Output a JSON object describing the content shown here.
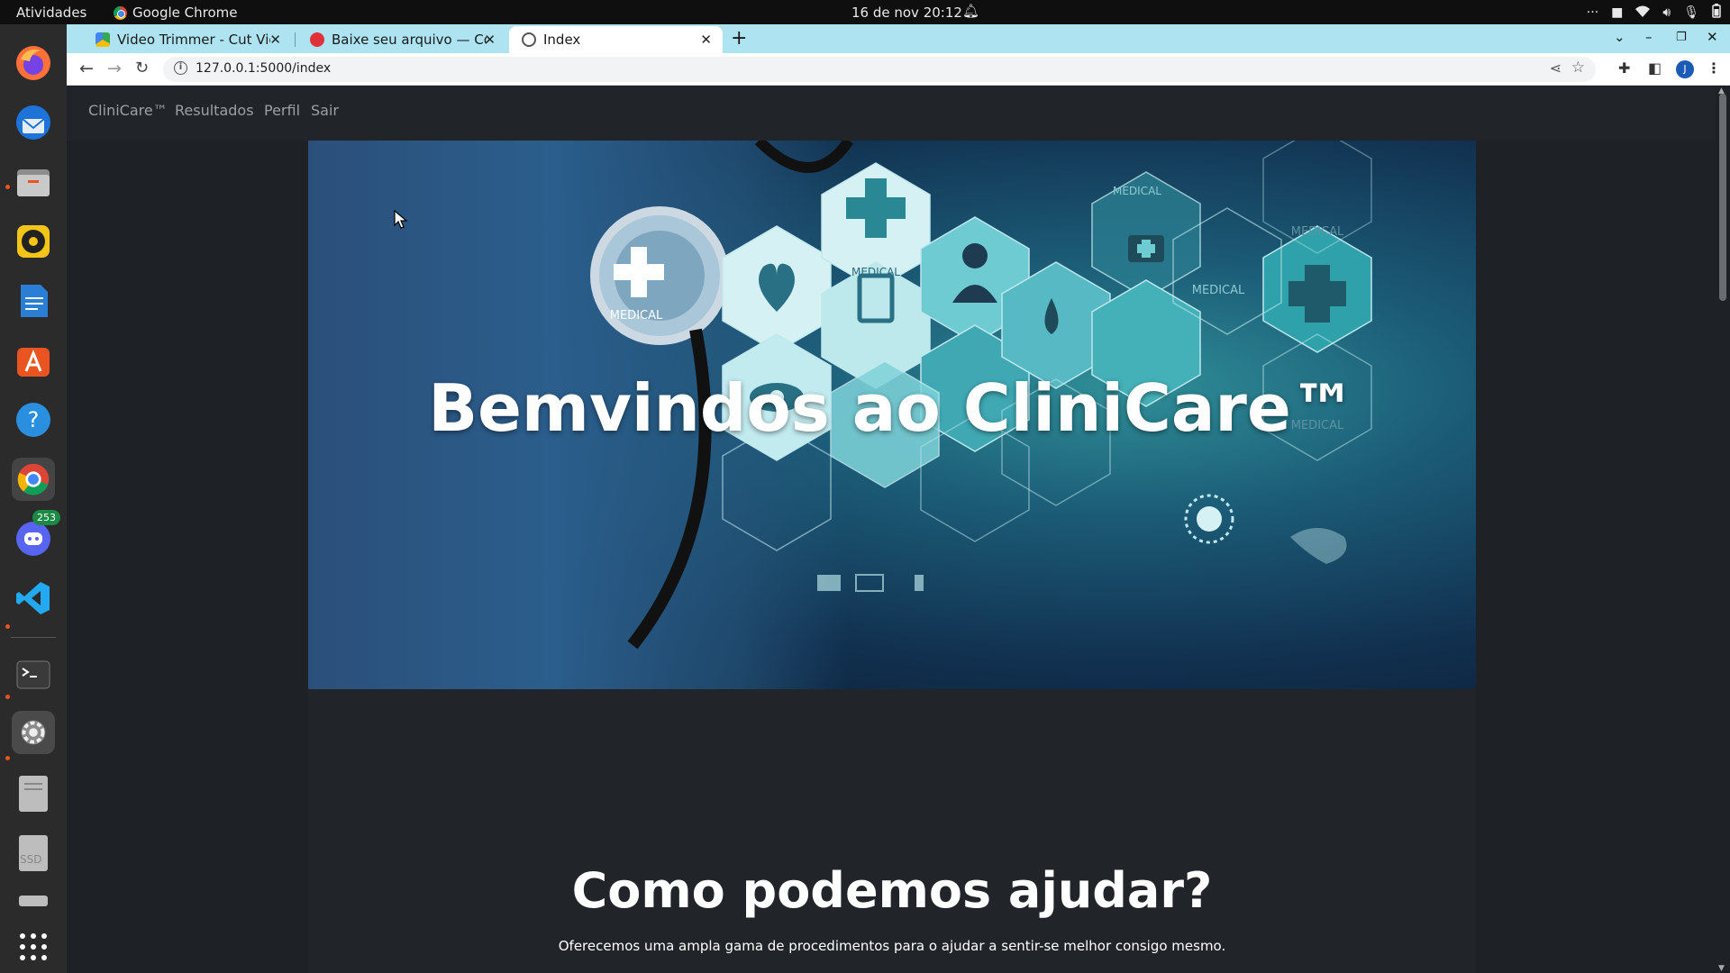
{
  "system_bar": {
    "activities": "Atividades",
    "app_name": "Google Chrome",
    "datetime": "16 de nov  20:12"
  },
  "dock": {
    "items": [
      {
        "name": "firefox-icon"
      },
      {
        "name": "thunderbird-icon"
      },
      {
        "name": "files-icon"
      },
      {
        "name": "rhythmbox-icon"
      },
      {
        "name": "writer-icon"
      },
      {
        "name": "software-center-icon"
      },
      {
        "name": "help-icon"
      },
      {
        "name": "chrome-icon"
      },
      {
        "name": "discord-icon",
        "badge": "253"
      },
      {
        "name": "vscode-icon"
      },
      {
        "name": "terminal-icon"
      },
      {
        "name": "settings-icon"
      },
      {
        "name": "disk-icon"
      },
      {
        "name": "ssd-icon",
        "label": "SSD"
      },
      {
        "name": "drive-icon"
      },
      {
        "name": "app-grid-icon"
      }
    ]
  },
  "browser": {
    "tabs": [
      {
        "title": "Video Trimmer - Cut Video",
        "active": false
      },
      {
        "title": "Baixe seu arquivo — Conv",
        "active": false
      },
      {
        "title": "Index",
        "active": true
      }
    ],
    "url": "127.0.0.1:5000/index",
    "profile_initial": "J"
  },
  "site": {
    "nav": {
      "brand": "CliniCare™",
      "links": [
        "Resultados",
        "Perfil",
        "Sair"
      ]
    },
    "hero": {
      "title": "Bemvindos ao CliniCare™",
      "image_labels": [
        "MEDICAL",
        "MEDICAL",
        "MEDICAL",
        "MEDICAL",
        "MEDICAL",
        "MEDICAL"
      ]
    },
    "section": {
      "title": "Como podemos ajudar?",
      "subtitle": "Oferecemos uma ampla gama de procedimentos para o ajudar a sentir-se melhor consigo mesmo."
    }
  },
  "colors": {
    "tabstrip": "#aee4f2",
    "page_bg": "#1e2125",
    "nav_bg": "#212529",
    "ubuntu_orange": "#e95420"
  }
}
